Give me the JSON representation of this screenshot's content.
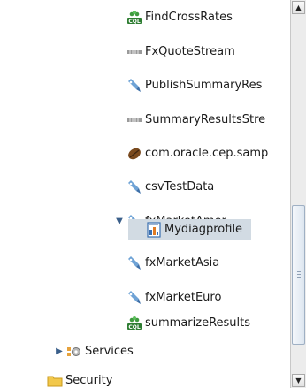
{
  "tree": {
    "items": [
      {
        "label": "FindCrossRates",
        "icon": "cql-icon"
      },
      {
        "label": "FxQuoteStream",
        "icon": "stream-icon"
      },
      {
        "label": "PublishSummaryRes",
        "icon": "adapter-icon"
      },
      {
        "label": "SummaryResultsStre",
        "icon": "stream-icon"
      },
      {
        "label": "com.oracle.cep.samp",
        "icon": "bean-icon"
      },
      {
        "label": "csvTestData",
        "icon": "adapter-icon"
      },
      {
        "label": "fxMarketAmer",
        "icon": "adapter-icon",
        "expanded": true
      },
      {
        "label": "Mydiagprofile",
        "icon": "profile-icon",
        "selected": true
      },
      {
        "label": "fxMarketAsia",
        "icon": "adapter-icon"
      },
      {
        "label": "fxMarketEuro",
        "icon": "adapter-icon"
      },
      {
        "label": "summarizeResults",
        "icon": "cql-icon"
      },
      {
        "label": "Services",
        "icon": "services-icon",
        "collapsed": true
      },
      {
        "label": "Security",
        "icon": "folder-icon"
      }
    ]
  },
  "colors": {
    "selection": "#d2dbe3",
    "arrow": "#3a5f8a"
  }
}
